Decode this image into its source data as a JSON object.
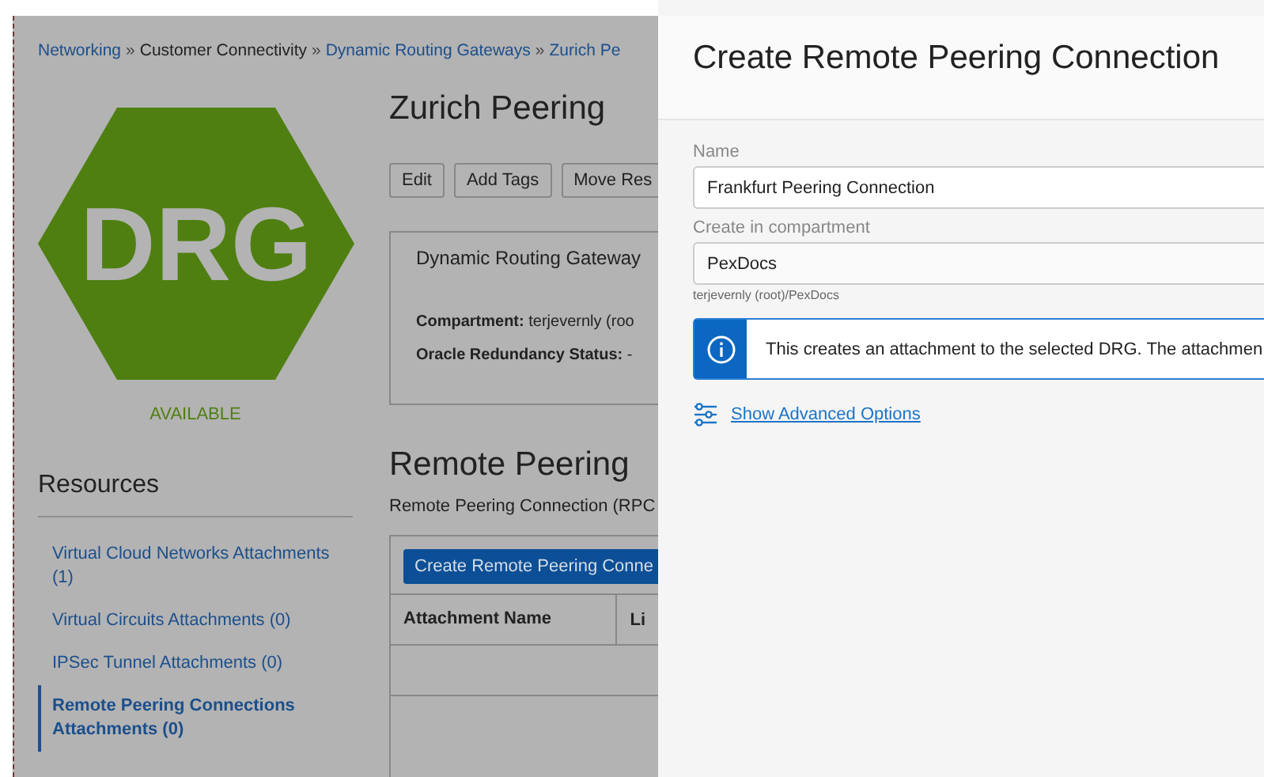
{
  "breadcrumb": [
    {
      "kind": "link",
      "label": "Networking"
    },
    {
      "kind": "separator",
      "label": "»"
    },
    {
      "kind": "text",
      "label": "Customer Connectivity"
    },
    {
      "kind": "separator",
      "label": "»"
    },
    {
      "kind": "link",
      "label": "Dynamic Routing Gateways"
    },
    {
      "kind": "separator",
      "label": "»"
    },
    {
      "kind": "link",
      "label": "Zurich Pe"
    }
  ],
  "resource": {
    "icon_text": "DRG",
    "status": "AVAILABLE",
    "title": "Zurich Peering"
  },
  "actions": [
    "Edit",
    "Add Tags",
    "Move Res"
  ],
  "info_card": {
    "heading": "Dynamic Routing Gateway",
    "fields": [
      {
        "label": "Compartment:",
        "value": "terjevernly (roo"
      },
      {
        "label": "Oracle Redundancy Status:",
        "value": "-"
      }
    ]
  },
  "sidebar": {
    "title": "Resources",
    "items": [
      {
        "label": "Virtual Cloud Networks Attachments (1)",
        "selected": false
      },
      {
        "label": "Virtual Circuits Attachments (0)",
        "selected": false
      },
      {
        "label": "IPSec Tunnel Attachments (0)",
        "selected": false
      },
      {
        "label": "Remote Peering Connections Attachments (0)",
        "selected": true
      }
    ]
  },
  "section": {
    "title": "Remote Peering",
    "description": "Remote Peering Connection (RPC",
    "create_button": "Create Remote Peering Conne",
    "columns": [
      "Attachment Name",
      "Li"
    ]
  },
  "panel": {
    "title": "Create Remote Peering Connection",
    "name_label": "Name",
    "name_value": "Frankfurt Peering Connection",
    "compartment_label": "Create in compartment",
    "compartment_value": "PexDocs",
    "compartment_path": "terjevernly (root)/PexDocs",
    "notice": "This creates an attachment to the selected DRG. The attachmen",
    "advanced_link": "Show Advanced Options"
  }
}
